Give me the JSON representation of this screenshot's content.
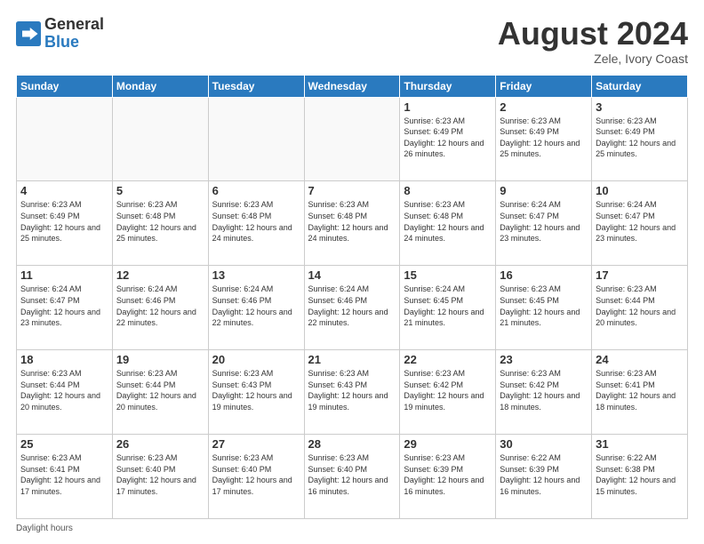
{
  "header": {
    "logo_line1": "General",
    "logo_line2": "Blue",
    "month_title": "August 2024",
    "location": "Zele, Ivory Coast"
  },
  "days_of_week": [
    "Sunday",
    "Monday",
    "Tuesday",
    "Wednesday",
    "Thursday",
    "Friday",
    "Saturday"
  ],
  "weeks": [
    [
      {
        "day": "",
        "info": ""
      },
      {
        "day": "",
        "info": ""
      },
      {
        "day": "",
        "info": ""
      },
      {
        "day": "",
        "info": ""
      },
      {
        "day": "1",
        "info": "Sunrise: 6:23 AM\nSunset: 6:49 PM\nDaylight: 12 hours\nand 26 minutes."
      },
      {
        "day": "2",
        "info": "Sunrise: 6:23 AM\nSunset: 6:49 PM\nDaylight: 12 hours\nand 25 minutes."
      },
      {
        "day": "3",
        "info": "Sunrise: 6:23 AM\nSunset: 6:49 PM\nDaylight: 12 hours\nand 25 minutes."
      }
    ],
    [
      {
        "day": "4",
        "info": "Sunrise: 6:23 AM\nSunset: 6:49 PM\nDaylight: 12 hours\nand 25 minutes."
      },
      {
        "day": "5",
        "info": "Sunrise: 6:23 AM\nSunset: 6:48 PM\nDaylight: 12 hours\nand 25 minutes."
      },
      {
        "day": "6",
        "info": "Sunrise: 6:23 AM\nSunset: 6:48 PM\nDaylight: 12 hours\nand 24 minutes."
      },
      {
        "day": "7",
        "info": "Sunrise: 6:23 AM\nSunset: 6:48 PM\nDaylight: 12 hours\nand 24 minutes."
      },
      {
        "day": "8",
        "info": "Sunrise: 6:23 AM\nSunset: 6:48 PM\nDaylight: 12 hours\nand 24 minutes."
      },
      {
        "day": "9",
        "info": "Sunrise: 6:24 AM\nSunset: 6:47 PM\nDaylight: 12 hours\nand 23 minutes."
      },
      {
        "day": "10",
        "info": "Sunrise: 6:24 AM\nSunset: 6:47 PM\nDaylight: 12 hours\nand 23 minutes."
      }
    ],
    [
      {
        "day": "11",
        "info": "Sunrise: 6:24 AM\nSunset: 6:47 PM\nDaylight: 12 hours\nand 23 minutes."
      },
      {
        "day": "12",
        "info": "Sunrise: 6:24 AM\nSunset: 6:46 PM\nDaylight: 12 hours\nand 22 minutes."
      },
      {
        "day": "13",
        "info": "Sunrise: 6:24 AM\nSunset: 6:46 PM\nDaylight: 12 hours\nand 22 minutes."
      },
      {
        "day": "14",
        "info": "Sunrise: 6:24 AM\nSunset: 6:46 PM\nDaylight: 12 hours\nand 22 minutes."
      },
      {
        "day": "15",
        "info": "Sunrise: 6:24 AM\nSunset: 6:45 PM\nDaylight: 12 hours\nand 21 minutes."
      },
      {
        "day": "16",
        "info": "Sunrise: 6:23 AM\nSunset: 6:45 PM\nDaylight: 12 hours\nand 21 minutes."
      },
      {
        "day": "17",
        "info": "Sunrise: 6:23 AM\nSunset: 6:44 PM\nDaylight: 12 hours\nand 20 minutes."
      }
    ],
    [
      {
        "day": "18",
        "info": "Sunrise: 6:23 AM\nSunset: 6:44 PM\nDaylight: 12 hours\nand 20 minutes."
      },
      {
        "day": "19",
        "info": "Sunrise: 6:23 AM\nSunset: 6:44 PM\nDaylight: 12 hours\nand 20 minutes."
      },
      {
        "day": "20",
        "info": "Sunrise: 6:23 AM\nSunset: 6:43 PM\nDaylight: 12 hours\nand 19 minutes."
      },
      {
        "day": "21",
        "info": "Sunrise: 6:23 AM\nSunset: 6:43 PM\nDaylight: 12 hours\nand 19 minutes."
      },
      {
        "day": "22",
        "info": "Sunrise: 6:23 AM\nSunset: 6:42 PM\nDaylight: 12 hours\nand 19 minutes."
      },
      {
        "day": "23",
        "info": "Sunrise: 6:23 AM\nSunset: 6:42 PM\nDaylight: 12 hours\nand 18 minutes."
      },
      {
        "day": "24",
        "info": "Sunrise: 6:23 AM\nSunset: 6:41 PM\nDaylight: 12 hours\nand 18 minutes."
      }
    ],
    [
      {
        "day": "25",
        "info": "Sunrise: 6:23 AM\nSunset: 6:41 PM\nDaylight: 12 hours\nand 17 minutes."
      },
      {
        "day": "26",
        "info": "Sunrise: 6:23 AM\nSunset: 6:40 PM\nDaylight: 12 hours\nand 17 minutes."
      },
      {
        "day": "27",
        "info": "Sunrise: 6:23 AM\nSunset: 6:40 PM\nDaylight: 12 hours\nand 17 minutes."
      },
      {
        "day": "28",
        "info": "Sunrise: 6:23 AM\nSunset: 6:40 PM\nDaylight: 12 hours\nand 16 minutes."
      },
      {
        "day": "29",
        "info": "Sunrise: 6:23 AM\nSunset: 6:39 PM\nDaylight: 12 hours\nand 16 minutes."
      },
      {
        "day": "30",
        "info": "Sunrise: 6:22 AM\nSunset: 6:39 PM\nDaylight: 12 hours\nand 16 minutes."
      },
      {
        "day": "31",
        "info": "Sunrise: 6:22 AM\nSunset: 6:38 PM\nDaylight: 12 hours\nand 15 minutes."
      }
    ]
  ],
  "footer": {
    "daylight_label": "Daylight hours"
  }
}
